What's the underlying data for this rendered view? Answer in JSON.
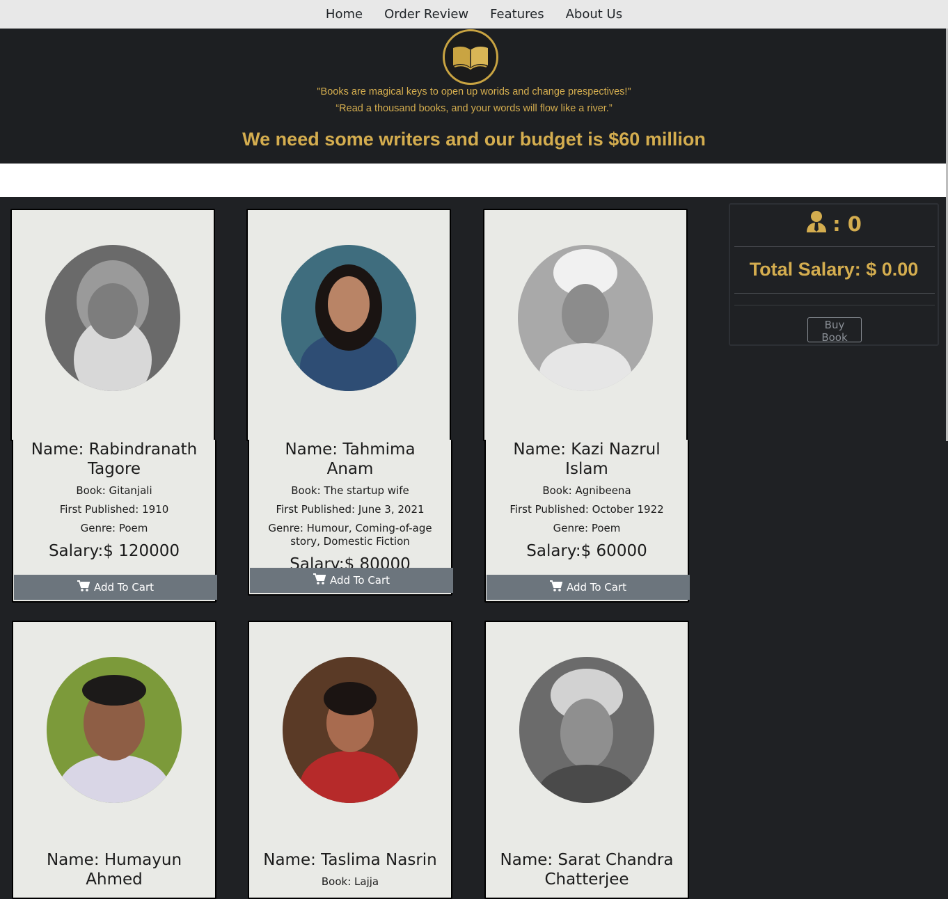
{
  "nav": {
    "items": [
      "Home",
      "Order Review",
      "Features",
      "About Us"
    ]
  },
  "hero": {
    "quote1": "\"Books are magical keys to open up worids and change prespectives!\"",
    "quote2": "“Read a thousand books, and your words will flow like a river.”",
    "budget": "We need some writers and our budget is $60 million"
  },
  "colors": {
    "gold": "#d4ad4f",
    "dark": "#1f2124",
    "card": "#e9eae6",
    "button": "#6c757d"
  },
  "writers": [
    {
      "name": "Name: Rabindranath Tagore",
      "book": "Book: Gitanjali",
      "published": "First Published: 1910",
      "genre": "Genre: Poem",
      "salary": "Salary:$ 120000",
      "cart": "Add To Cart"
    },
    {
      "name": "Name: Tahmima Anam",
      "book": "Book: The startup wife",
      "published": "First Published: June 3, 2021",
      "genre": "Genre: Humour, Coming-of-age story, Domestic Fiction",
      "salary": "Salary:$ 80000",
      "cart": "Add To Cart"
    },
    {
      "name": "Name: Kazi Nazrul Islam",
      "book": "Book: Agnibeena",
      "published": "First Published: October 1922",
      "genre": "Genre: Poem",
      "salary": "Salary:$ 60000",
      "cart": "Add To Cart"
    },
    {
      "name": "Name: Humayun Ahmed"
    },
    {
      "name": "Name: Taslima Nasrin",
      "book": "Book: Lajja"
    },
    {
      "name": "Name: Sarat Chandra Chatterjee"
    }
  ],
  "summary": {
    "count": ": 0",
    "total": "Total Salary: $ 0.00",
    "buy": "Buy Book",
    "icon": "user-tie-icon"
  }
}
